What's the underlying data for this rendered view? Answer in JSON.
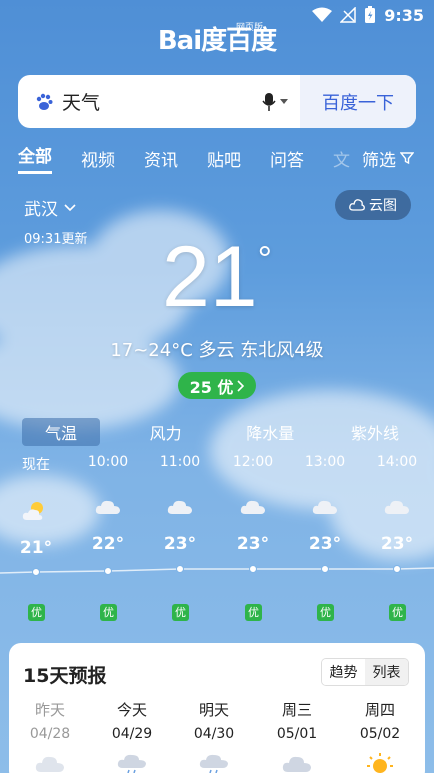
{
  "status_bar": {
    "time": "9:35"
  },
  "header": {
    "logo": "Bai度百度",
    "logo_sub": "网页版"
  },
  "search": {
    "query": "天气",
    "button": "百度一下"
  },
  "nav_tabs": [
    {
      "label": "全部",
      "active": true
    },
    {
      "label": "视频"
    },
    {
      "label": "资讯"
    },
    {
      "label": "贴吧"
    },
    {
      "label": "问答"
    },
    {
      "label": "文"
    }
  ],
  "filter_label": "筛选",
  "weather": {
    "city": "武汉",
    "updated": "09:31更新",
    "cloud_map": "云图",
    "temperature": "21",
    "degree": "°",
    "summary": "17~24°C  多云  东北风4级",
    "aqi": "25 优"
  },
  "sub_tabs": [
    {
      "label": "气温",
      "active": true
    },
    {
      "label": "风力"
    },
    {
      "label": "降水量"
    },
    {
      "label": "紫外线"
    }
  ],
  "hourly": [
    {
      "time": "现在",
      "icon": "partly-cloudy-icon",
      "temp": "21°",
      "quality": "优"
    },
    {
      "time": "10:00",
      "icon": "cloudy-icon",
      "temp": "22°",
      "quality": "优"
    },
    {
      "time": "11:00",
      "icon": "cloudy-icon",
      "temp": "23°",
      "quality": "优"
    },
    {
      "time": "12:00",
      "icon": "cloudy-icon",
      "temp": "23°",
      "quality": "优"
    },
    {
      "time": "13:00",
      "icon": "cloudy-icon",
      "temp": "23°",
      "quality": "优"
    },
    {
      "time": "14:00",
      "icon": "cloudy-icon",
      "temp": "23°",
      "quality": "优"
    }
  ],
  "forecast": {
    "title": "15天预报",
    "toggle_trend": "趋势",
    "toggle_list": "列表",
    "days": [
      {
        "day": "昨天",
        "date": "04/28",
        "icon": "cloudy-icon"
      },
      {
        "day": "今天",
        "date": "04/29",
        "icon": "cloud-rain-icon"
      },
      {
        "day": "明天",
        "date": "04/30",
        "icon": "cloud-rain-icon"
      },
      {
        "day": "周三",
        "date": "05/01",
        "icon": "cloudy-icon"
      },
      {
        "day": "周四",
        "date": "05/02",
        "icon": "sun-icon"
      }
    ]
  },
  "colors": {
    "sky": "#5e9ddd",
    "quality_green": "#2fb44a",
    "link_blue": "#3a63d8"
  }
}
